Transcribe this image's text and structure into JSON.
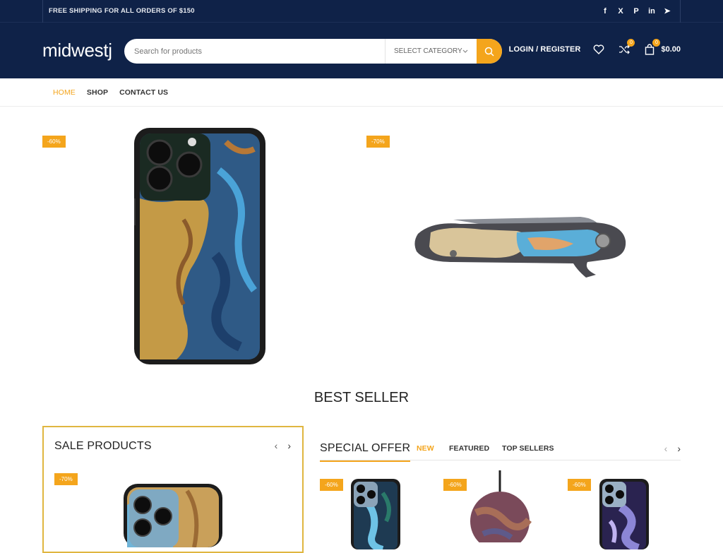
{
  "topbar": {
    "shipping_text": "FREE SHIPPING FOR ALL ORDERS OF $150",
    "socials": [
      "facebook-icon",
      "x-icon",
      "pinterest-icon",
      "linkedin-icon",
      "telegram-icon"
    ],
    "social_glyphs": [
      "f",
      "X",
      "P",
      "in",
      "➤"
    ]
  },
  "header": {
    "logo": "midwestj",
    "search_placeholder": "Search for products",
    "category_label": "SELECT CATEGORY",
    "login_label": "LOGIN / REGISTER",
    "compare_count": "0",
    "cart_count": "0",
    "cart_total": "$0.00"
  },
  "nav": {
    "items": [
      {
        "label": "HOME",
        "active": true
      },
      {
        "label": "SHOP",
        "active": false
      },
      {
        "label": "CONTACT US",
        "active": false
      }
    ]
  },
  "hero": {
    "badge_left": "-60%",
    "badge_right": "-70%"
  },
  "best_seller_title": "BEST SELLER",
  "sale_products": {
    "title": "SALE PRODUCTS",
    "badge": "-70%"
  },
  "special": {
    "title": "SPECIAL OFFER",
    "tabs": [
      {
        "label": "NEW",
        "active": true
      },
      {
        "label": "FEATURED",
        "active": false
      },
      {
        "label": "TOP SELLERS",
        "active": false
      }
    ],
    "products": [
      {
        "badge": "-60%"
      },
      {
        "badge": "-60%"
      },
      {
        "badge": "-60%"
      }
    ]
  },
  "colors": {
    "navy": "#0f2248",
    "accent": "#f4a51c"
  }
}
